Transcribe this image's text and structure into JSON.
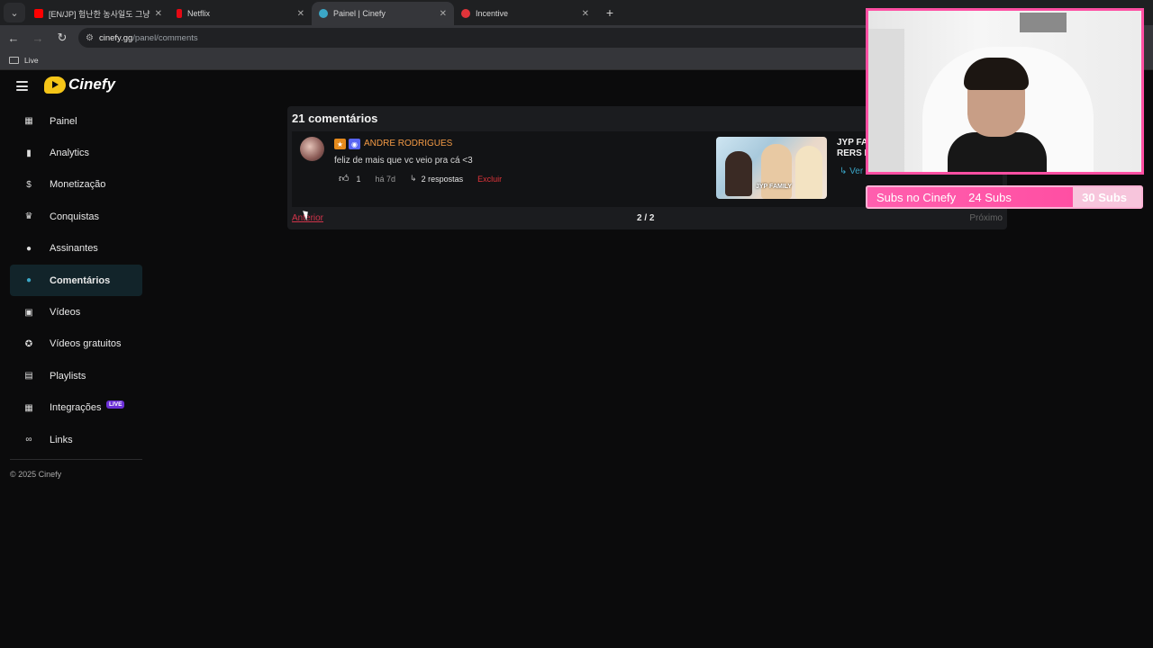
{
  "browser": {
    "tabs": [
      {
        "label": "[EN/JP] 험난한 농사일도 그냥 ...",
        "favicon_color": "#ff0000",
        "active": false
      },
      {
        "label": "Netflix",
        "favicon_color": "#e50914",
        "active": false
      },
      {
        "label": "Painel | Cinefy",
        "favicon_color": "#3ba7c7",
        "active": true
      },
      {
        "label": "Incentive",
        "favicon_color": "#e0343a",
        "active": false
      }
    ],
    "url_host": "cinefy.gg",
    "url_path": "/panel/comments",
    "bookmark_folder": "Live"
  },
  "sidebar": {
    "logo_text": "Cinefy",
    "items": [
      {
        "label": "Painel",
        "icon": "dashboard-icon"
      },
      {
        "label": "Analytics",
        "icon": "bar-chart-icon"
      },
      {
        "label": "Monetização",
        "icon": "dollar-icon"
      },
      {
        "label": "Conquistas",
        "icon": "trophy-icon"
      },
      {
        "label": "Assinantes",
        "icon": "users-icon"
      },
      {
        "label": "Comentários",
        "icon": "comment-icon",
        "active": true
      },
      {
        "label": "Vídeos",
        "icon": "video-icon"
      },
      {
        "label": "Vídeos gratuitos",
        "icon": "star-circle-icon"
      },
      {
        "label": "Playlists",
        "icon": "playlist-icon"
      },
      {
        "label": "Integrações",
        "icon": "grid-icon",
        "badge": "LIVE"
      },
      {
        "label": "Links",
        "icon": "link-icon"
      }
    ],
    "copyright": "© 2025 Cinefy"
  },
  "comments": {
    "title": "21 comentários",
    "items": [
      {
        "author": "ANDRE RODRIGUES",
        "text": "feliz de mais que vc veio pra cá <3",
        "likes": "1",
        "time": "há 7d",
        "replies": "2 respostas",
        "delete_label": "Excluir",
        "video_title": "JYP FA RERS I",
        "video_thumb_text": "JYP FAMILY",
        "see_all": "Ver todos os comentários"
      }
    ],
    "pagination": {
      "prev": "Anterior",
      "page": "2 / 2",
      "next": "Próximo"
    }
  },
  "overlay": {
    "subs_label": "Subs no Cinefy",
    "subs_current": "24 Subs",
    "subs_goal": "30 Subs",
    "accent": "#ff4fa3"
  }
}
